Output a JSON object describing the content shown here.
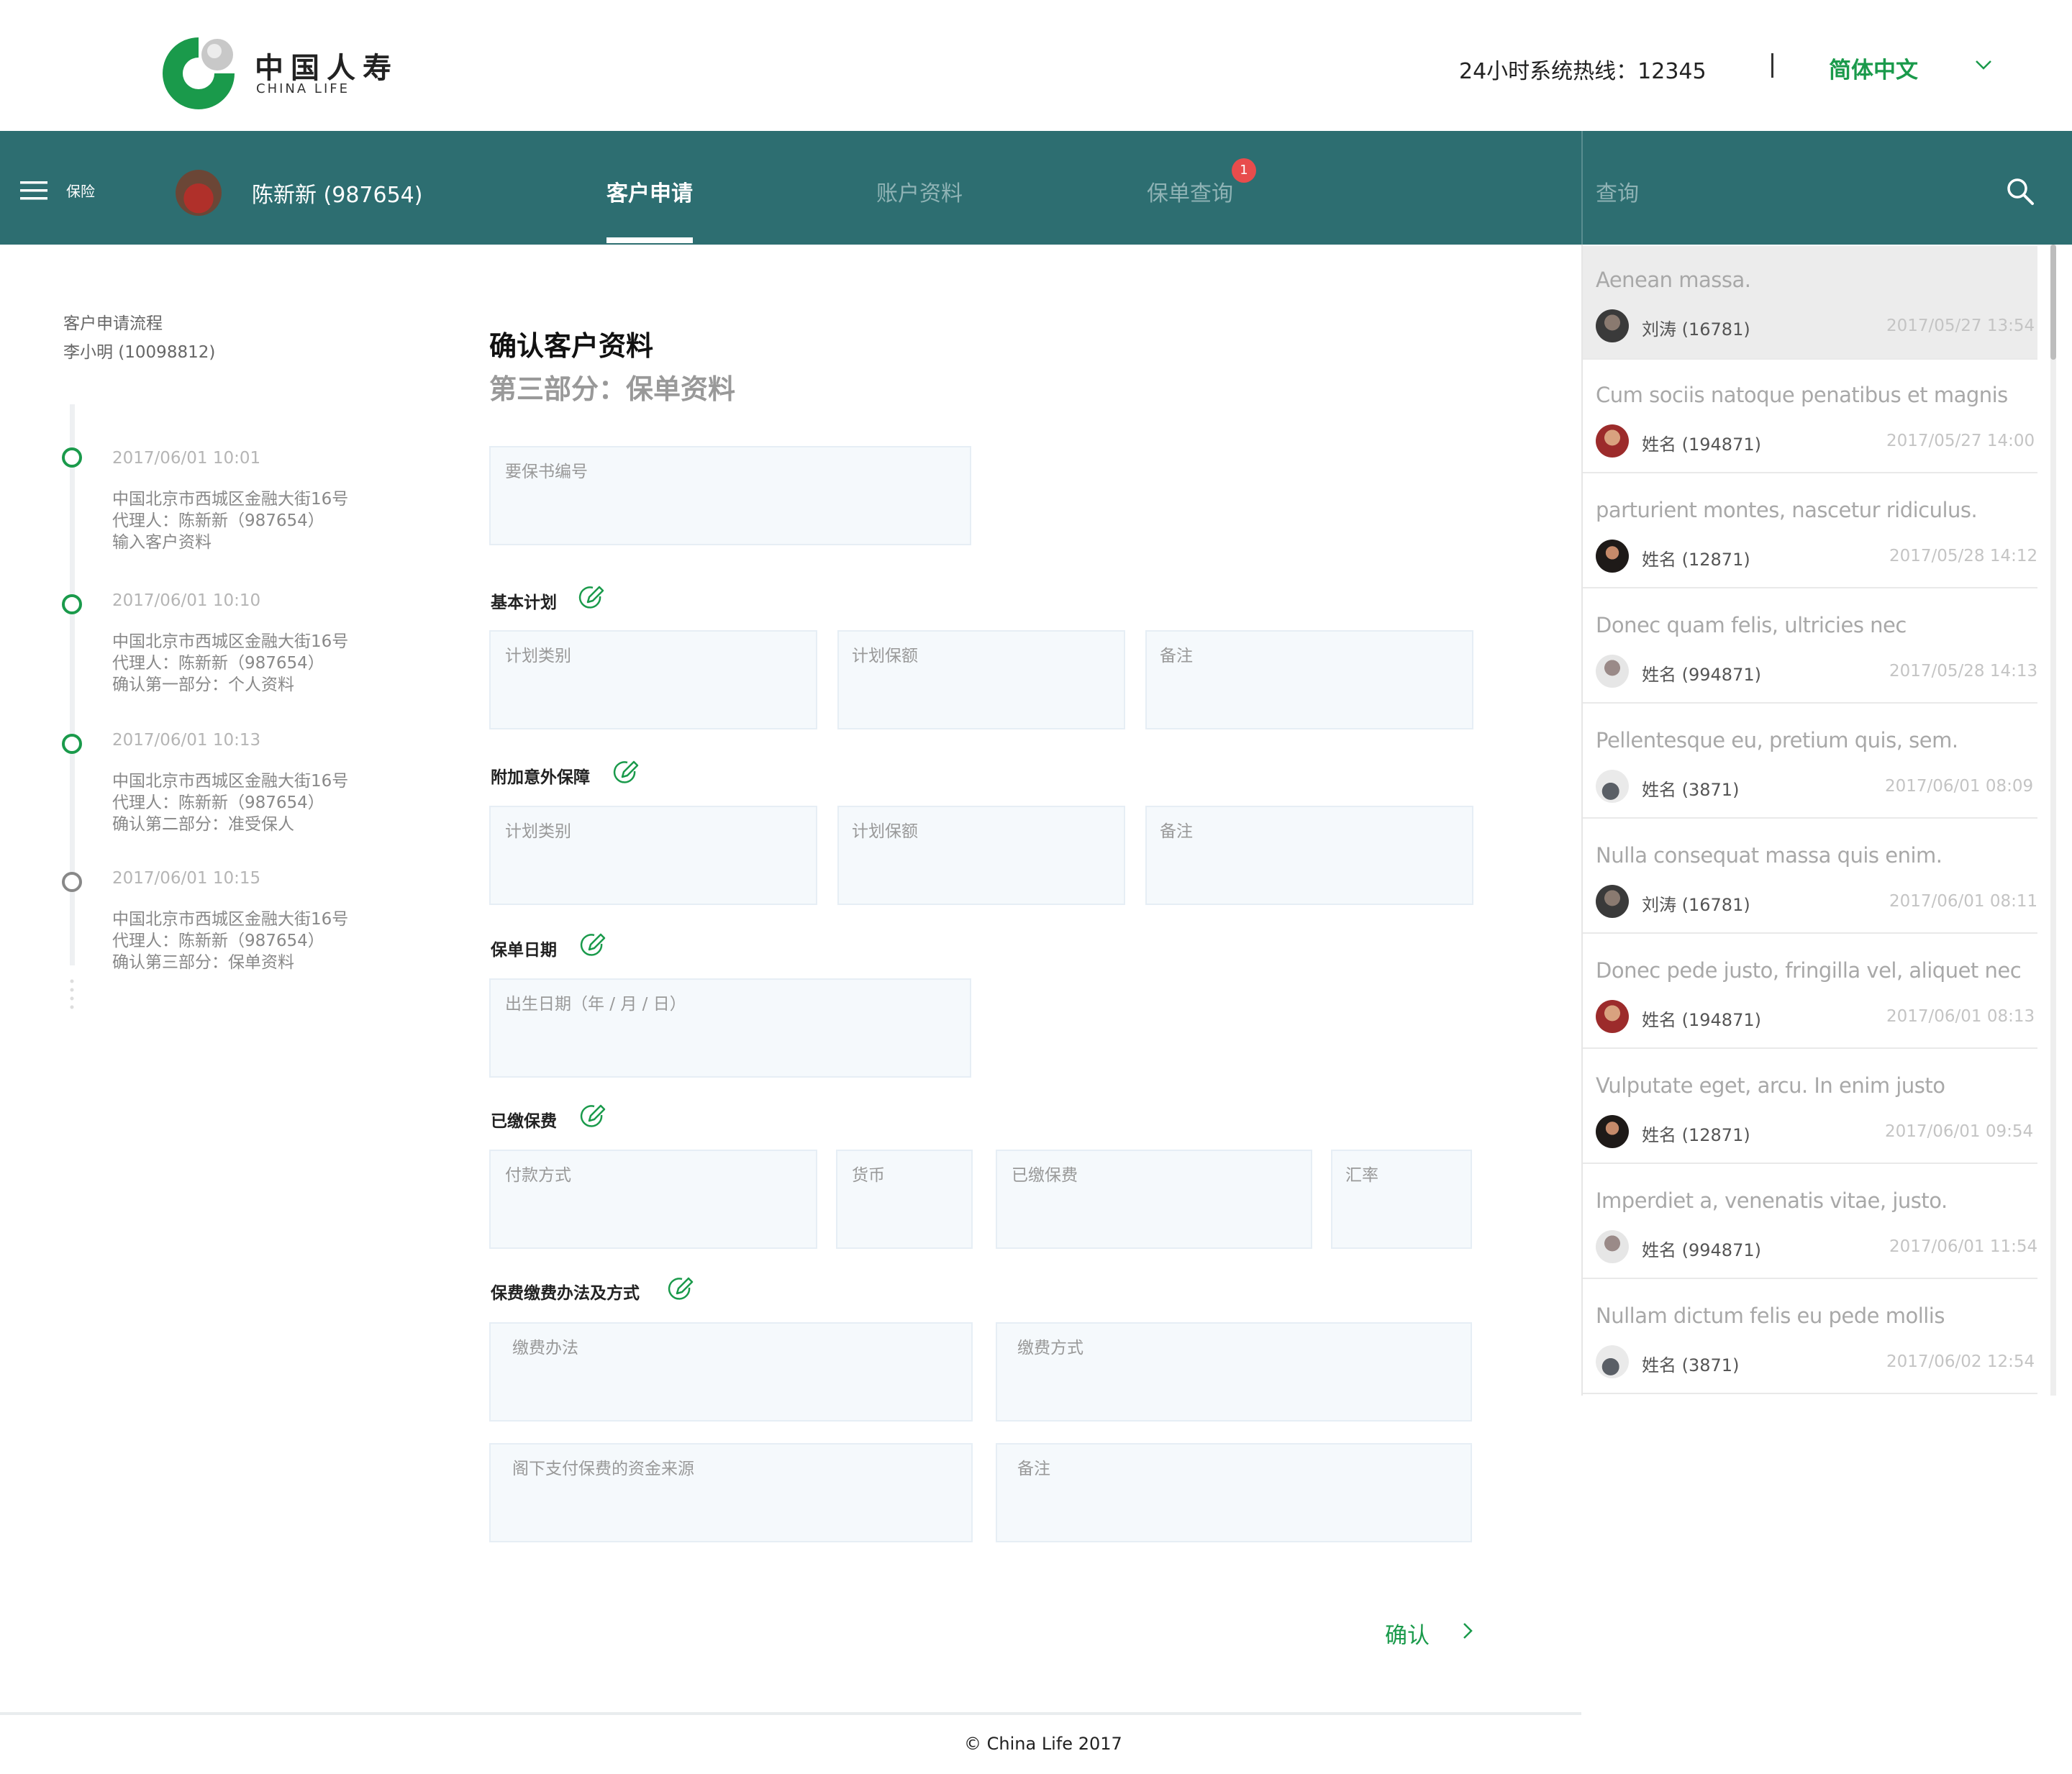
{
  "header": {
    "logo_cn": "中国人寿",
    "logo_en": "CHINA LIFE",
    "hotline": "24小时系统热线：12345",
    "language": "简体中文",
    "brand_color": "#1a9a4b"
  },
  "nav": {
    "section": "保险",
    "user": "陈新新 (987654)",
    "tabs": [
      {
        "label": "客户申请",
        "active": true
      },
      {
        "label": "账户资料",
        "active": false
      },
      {
        "label": "保单查询",
        "active": false,
        "badge": "1"
      }
    ],
    "search_label": "查询",
    "bar_color": "#2d6e71"
  },
  "timeline": {
    "title": "客户申请流程",
    "subtitle": "李小明 (10098812)",
    "steps": [
      {
        "time": "2017/06/01  10:01",
        "address": "中国北京市西城区金融大街16号",
        "agent": "代理人：陈新新（987654）",
        "action": "输入客户资料",
        "status": "done"
      },
      {
        "time": "2017/06/01  10:10",
        "address": "中国北京市西城区金融大街16号",
        "agent": "代理人：陈新新（987654）",
        "action": "确认第一部分：个人资料",
        "status": "done"
      },
      {
        "time": "2017/06/01  10:13",
        "address": "中国北京市西城区金融大街16号",
        "agent": "代理人：陈新新（987654）",
        "action": "确认第二部分：准受保人",
        "status": "done"
      },
      {
        "time": "2017/06/01  10:15",
        "address": "中国北京市西城区金融大街16号",
        "agent": "代理人：陈新新（987654）",
        "action": "确认第三部分：保单资料",
        "status": "pending"
      }
    ]
  },
  "form": {
    "title": "确认客户资料",
    "subtitle": "第三部分：保单资料",
    "proposal_no": "要保书编号",
    "basic_plan": {
      "label": "基本计划",
      "type": "计划类别",
      "amount": "计划保额",
      "note": "备注"
    },
    "accident": {
      "label": "附加意外保障",
      "type": "计划类别",
      "amount": "计划保额",
      "note": "备注"
    },
    "policy_date": {
      "label": "保单日期",
      "birth": "出生日期（年 / 月 / 日）"
    },
    "paid": {
      "label": "已缴保费",
      "method": "付款方式",
      "currency": "货币",
      "paid": "已缴保费",
      "rate": "汇率"
    },
    "payment": {
      "label": "保费缴费办法及方式",
      "way": "缴费办法",
      "mode": "缴费方式",
      "source": "阁下支付保费的资金来源",
      "note": "备注"
    },
    "confirm": "确认"
  },
  "list": [
    {
      "title": "Aenean massa.",
      "name": "刘涛 (16781)",
      "date": "2017/05/27   13:54",
      "selected": true
    },
    {
      "title": "Cum sociis natoque penatibus et magnis",
      "name": "姓名 (194871)",
      "date": "2017/05/27   14:00"
    },
    {
      "title": "parturient montes, nascetur ridiculus.",
      "name": "姓名 (12871)",
      "date": "2017/05/28   14:12"
    },
    {
      "title": "Donec quam felis, ultricies nec",
      "name": "姓名 (994871)",
      "date": "2017/05/28   14:13"
    },
    {
      "title": "Pellentesque eu, pretium quis, sem.",
      "name": "姓名 (3871)",
      "date": "2017/06/01   08:09"
    },
    {
      "title": "Nulla consequat massa quis enim.",
      "name": "刘涛 (16781)",
      "date": "2017/06/01   08:11"
    },
    {
      "title": "Donec pede justo, fringilla vel, aliquet nec",
      "name": "姓名 (194871)",
      "date": "2017/06/01   08:13"
    },
    {
      "title": "Vulputate eget, arcu. In enim justo",
      "name": "姓名 (12871)",
      "date": "2017/06/01   09:54"
    },
    {
      "title": "Imperdiet a, venenatis vitae, justo.",
      "name": "姓名 (994871)",
      "date": "2017/06/01   11:54"
    },
    {
      "title": "Nullam dictum felis eu pede mollis",
      "name": "姓名 (3871)",
      "date": "2017/06/02   12:54"
    }
  ],
  "footer": "© China Life 2017"
}
